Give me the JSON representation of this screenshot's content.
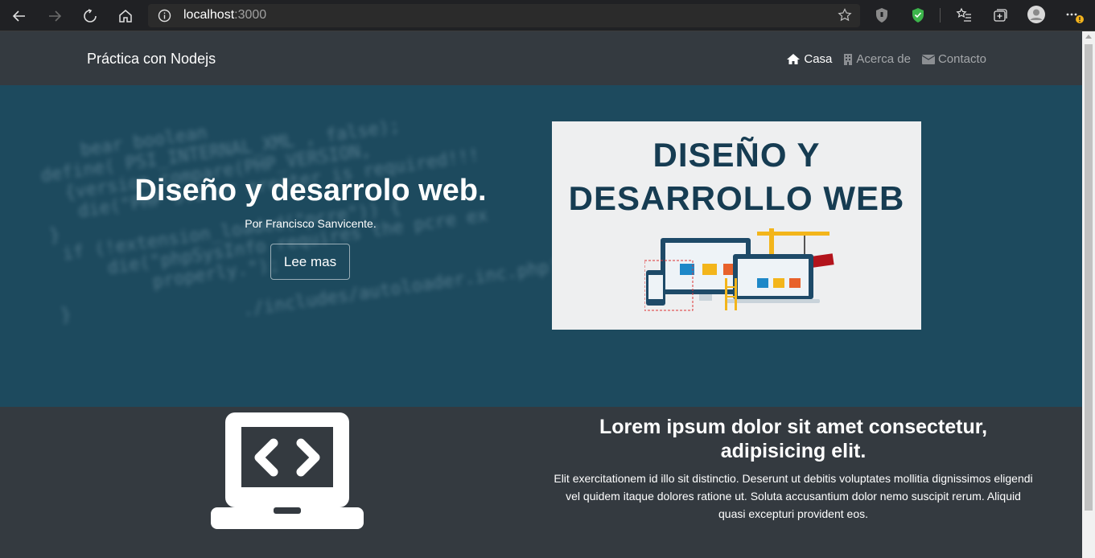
{
  "browser": {
    "url_host": "localhost",
    "url_port": ":3000"
  },
  "navbar": {
    "brand": "Práctica con Nodejs",
    "links": [
      {
        "label": "Casa",
        "icon": "home-icon",
        "active": true
      },
      {
        "label": "Acerca de",
        "icon": "building-icon",
        "active": false
      },
      {
        "label": "Contacto",
        "icon": "envelope-icon",
        "active": false
      }
    ]
  },
  "hero": {
    "title": "Diseño y desarrolo web.",
    "subtitle": "Por Francisco Sanvicente.",
    "button": "Lee mas",
    "image_line1": "DISEÑO Y",
    "image_line2": "DESARROLLO WEB"
  },
  "feature": {
    "title": "Lorem ipsum dolor sit amet consectetur, adipisicing elit.",
    "text": "Elit exercitationem id illo sit distinctio. Deserunt ut debitis voluptates mollitia dignissimos eligendi vel quidem itaque dolores ratione ut. Soluta accusantium dolor nemo suscipit rerum. Aliquid quasi excepturi provident eos."
  },
  "colors": {
    "navbar_bg": "#343a40",
    "hero_bg": "#1d4a5e",
    "image_text": "#163c52"
  }
}
